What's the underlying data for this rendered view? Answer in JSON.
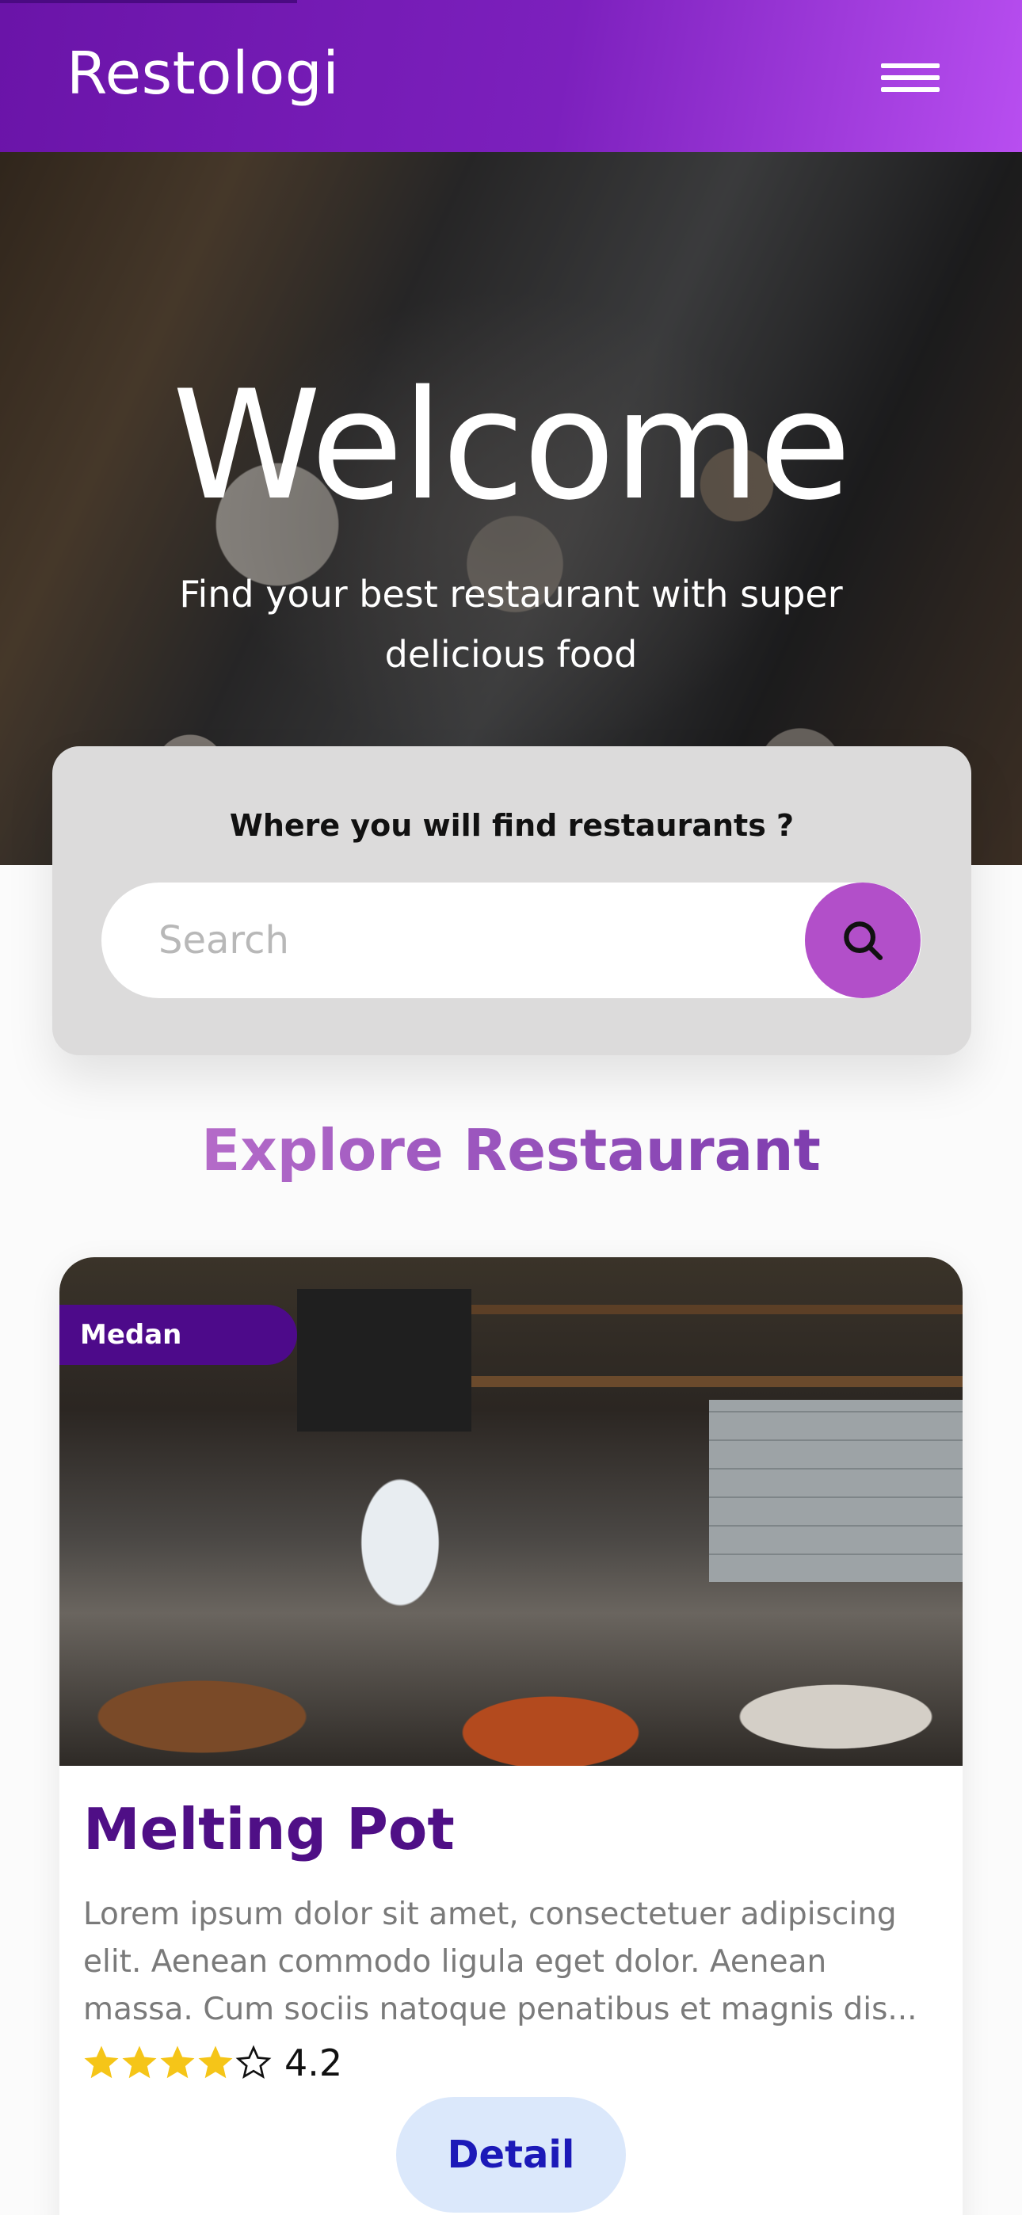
{
  "header": {
    "brand": "Restologi",
    "menu_icon": "hamburger-menu-icon"
  },
  "hero": {
    "title": "Welcome",
    "subtitle": "Find your best restaurant with super delicious food"
  },
  "search": {
    "question": "Where you will find restaurants ?",
    "placeholder": "Search",
    "value": "",
    "button_icon": "search-icon"
  },
  "section": {
    "title": "Explore Restaurant"
  },
  "restaurants": [
    {
      "city": "Medan",
      "name": "Melting Pot",
      "description": "Lorem ipsum dolor sit amet, consectetuer adipiscing elit. Aenean commodo ligula eget dolor. Aenean massa. Cum sociis natoque penatibus et magnis dis...",
      "rating": 4.2,
      "rating_label": "4.2",
      "stars_filled": 4,
      "stars_total": 5,
      "detail_label": "Detail"
    }
  ],
  "colors": {
    "header_start": "#6a14a8",
    "header_end": "#b84ef0",
    "search_button": "#b24fc9",
    "tag_bg": "#4d0a8a",
    "title_purple": "#4f0f86",
    "star": "#f5c518",
    "detail_bg": "#dbe8fb",
    "detail_text": "#1c19b8"
  }
}
